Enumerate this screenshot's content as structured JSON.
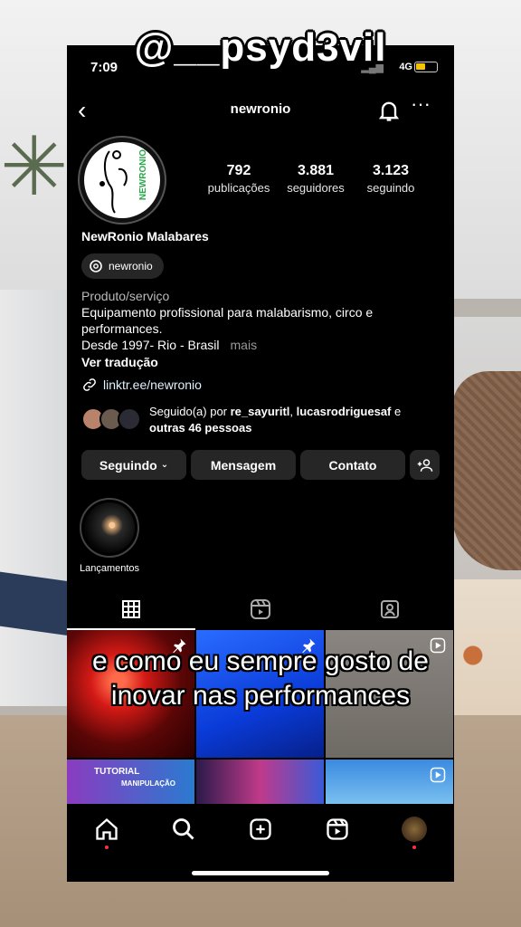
{
  "overlay": {
    "watermark": "@__psyd3vil",
    "caption_line1": "e como eu sempre gosto de",
    "caption_line2": "inovar nas performances"
  },
  "status_bar": {
    "time": "7:09",
    "network": "4G"
  },
  "header": {
    "username": "newronio"
  },
  "profile": {
    "logo_text": "NEWRONIO",
    "stats": [
      {
        "value": "792",
        "label": "publicações"
      },
      {
        "value": "3.881",
        "label": "seguidores"
      },
      {
        "value": "3.123",
        "label": "seguindo"
      }
    ],
    "full_name": "NewRonio Malabares",
    "threads_handle": "newronio",
    "category": "Produto/serviço",
    "bio_line1": "Equipamento profissional para malabarismo, circo e",
    "bio_line2": "performances.",
    "bio_line3": "Desde 1997- Rio - Brasil",
    "more_label": "mais",
    "translate_label": "Ver tradução",
    "link": "linktr.ee/newronio",
    "followed_prefix": "Seguido(a) por ",
    "followed_user1": "re_sayuritl",
    "followed_sep": ", ",
    "followed_user2": "lucasrodriguesaf",
    "followed_and": " e",
    "followed_others": "outras 46 pessoas"
  },
  "actions": {
    "following_label": "Seguindo",
    "message_label": "Mensagem",
    "contact_label": "Contato"
  },
  "highlights": [
    {
      "label": "Lançamentos"
    }
  ],
  "grid": {
    "tutorial_text": "TUTORIAL",
    "tutorial_sub": "MANIPULAÇÃO"
  },
  "icons": {
    "back": "chevron-left-icon",
    "bell": "bell-icon",
    "more": "more-horizontal-icon",
    "grid_tab": "grid-icon",
    "reels_tab": "reels-icon",
    "tagged_tab": "tagged-icon",
    "home": "home-icon",
    "search": "search-icon",
    "create": "plus-square-icon",
    "reels": "reels-icon"
  },
  "colors": {
    "background": "#000000",
    "button": "#262626",
    "notification_dot": "#ff3040",
    "battery": "#f5c400"
  }
}
